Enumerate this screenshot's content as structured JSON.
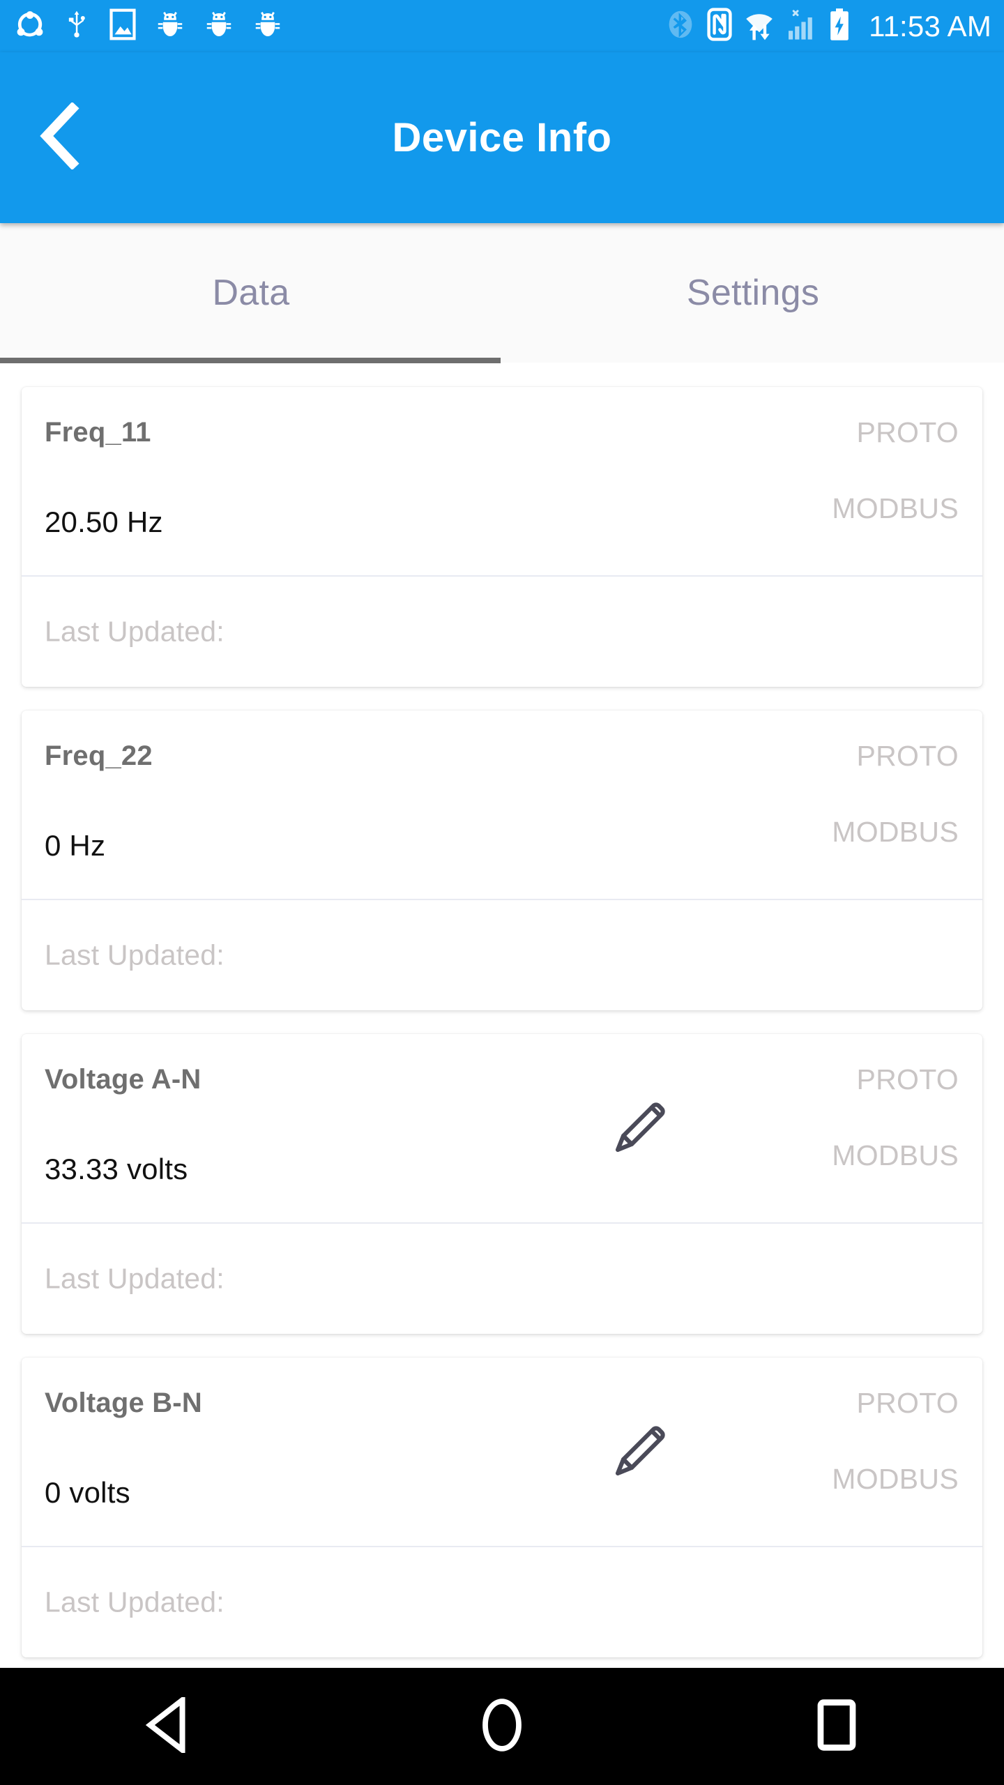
{
  "theme": {
    "accent": "#1299ec",
    "tab_text": "#8b8ba6",
    "tab_indicator": "#6e6e6e",
    "card_label": "#6f6f6f",
    "card_value": "#111111",
    "muted": "#c9c5c5",
    "divider": "#e8eaf2",
    "navbar_bg": "#000000",
    "tabbar_bg": "#fafafa",
    "edit_icon": "#4a4a58"
  },
  "statusbar": {
    "time": "11:53 AM",
    "left_icons": [
      "share-sync-icon",
      "usb-icon",
      "image-screenshot-icon",
      "bug-icon",
      "bug-icon",
      "bug-icon"
    ],
    "right_icons": [
      "bluetooth-icon",
      "nfc-icon",
      "wifi-transfer-icon",
      "cellular-signal-no-sim-icon",
      "battery-charging-icon"
    ]
  },
  "appbar": {
    "title": "Device Info",
    "back_icon": "back-chevron-icon"
  },
  "tabs": [
    {
      "label": "Data",
      "active": true
    },
    {
      "label": "Settings",
      "active": false
    }
  ],
  "cards": [
    {
      "label": "Freq_11",
      "value": "20.50 Hz",
      "proto": "PROTO",
      "modbus": "MODBUS",
      "last_updated": "Last Updated:",
      "editable": false
    },
    {
      "label": "Freq_22",
      "value": "0 Hz",
      "proto": "PROTO",
      "modbus": "MODBUS",
      "last_updated": "Last Updated:",
      "editable": false
    },
    {
      "label": "Voltage A-N",
      "value": "33.33 volts",
      "proto": "PROTO",
      "modbus": "MODBUS",
      "last_updated": "Last Updated:",
      "editable": true
    },
    {
      "label": "Voltage B-N",
      "value": "0 volts",
      "proto": "PROTO",
      "modbus": "MODBUS",
      "last_updated": "Last Updated:",
      "editable": true
    }
  ],
  "navbar": {
    "back": "back-triangle-icon",
    "home": "home-circle-icon",
    "recents": "recents-square-icon"
  }
}
